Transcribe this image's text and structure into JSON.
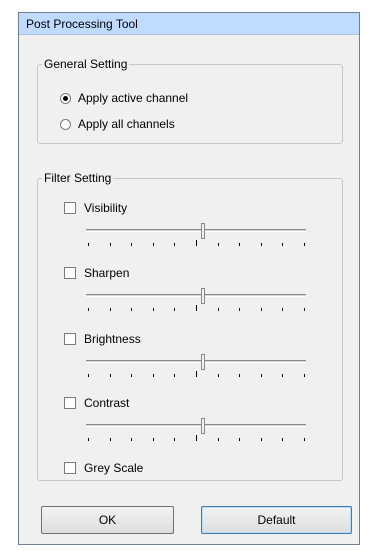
{
  "window": {
    "title": "Post Processing Tool"
  },
  "general": {
    "legend": "General Setting",
    "options": [
      {
        "label": "Apply active channel",
        "selected": true
      },
      {
        "label": "Apply all channels",
        "selected": false
      }
    ]
  },
  "filter": {
    "legend": "Filter Setting",
    "items": [
      {
        "label": "Visibility",
        "checked": false,
        "has_slider": true
      },
      {
        "label": "Sharpen",
        "checked": false,
        "has_slider": true
      },
      {
        "label": "Brightness",
        "checked": false,
        "has_slider": true
      },
      {
        "label": "Contrast",
        "checked": false,
        "has_slider": true
      },
      {
        "label": "Grey Scale",
        "checked": false,
        "has_slider": false
      }
    ]
  },
  "buttons": {
    "ok": "OK",
    "default": "Default"
  }
}
